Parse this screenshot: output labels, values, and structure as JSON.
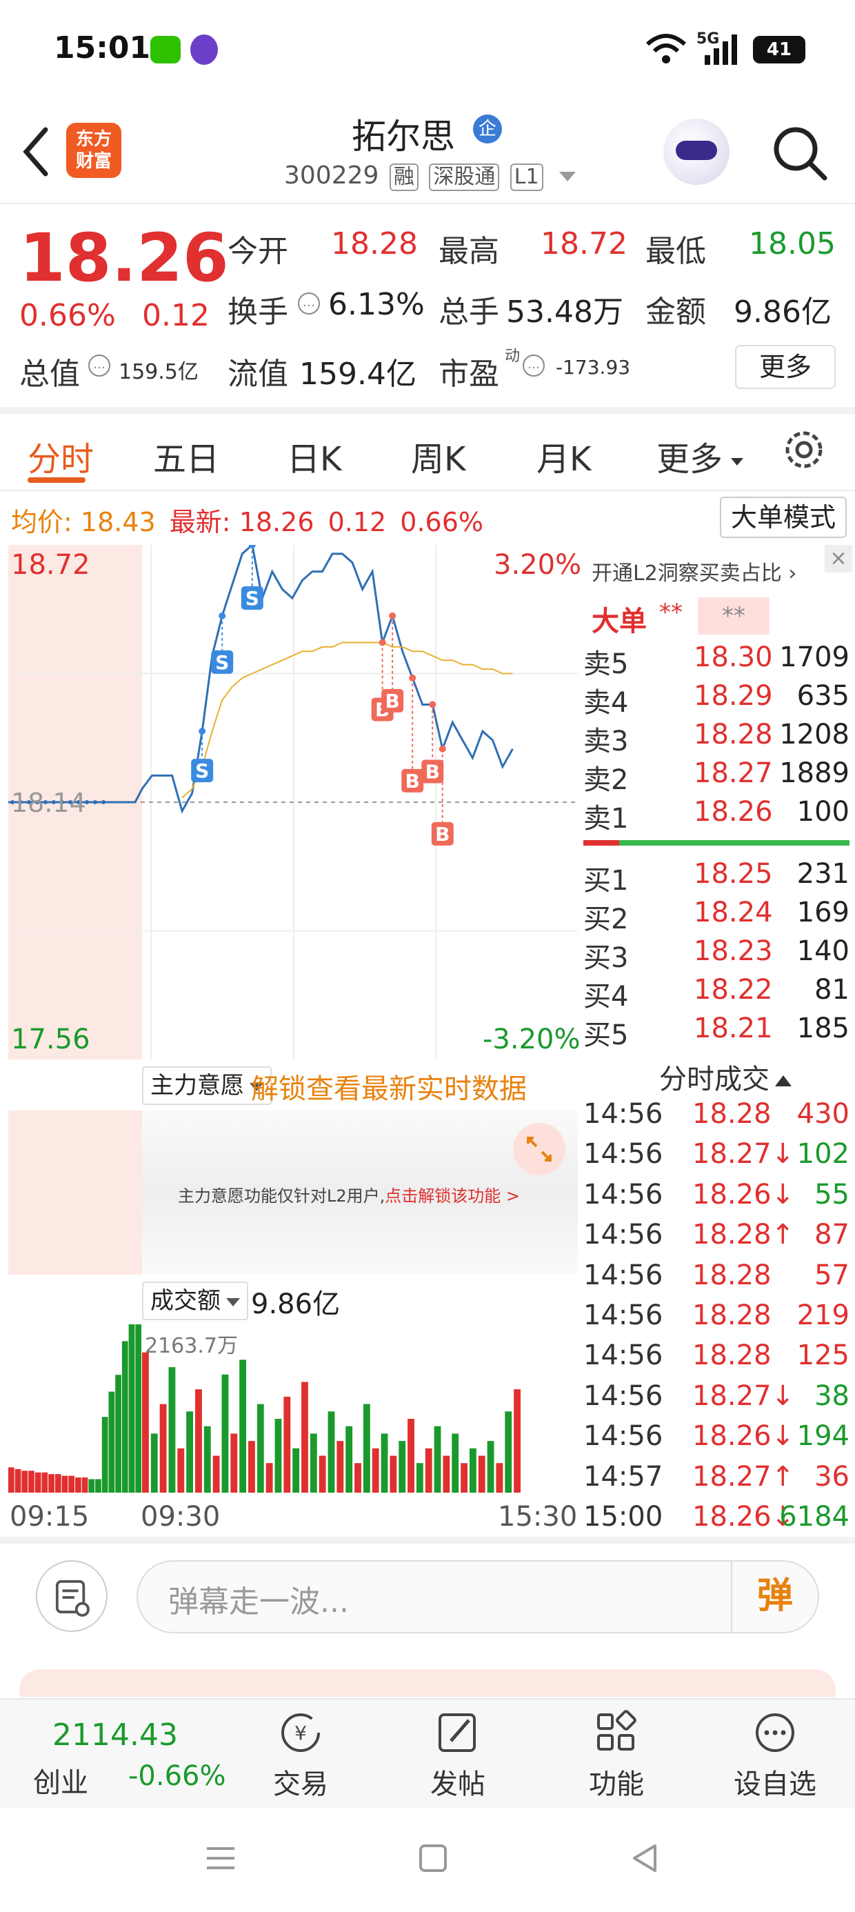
{
  "status_bar": {
    "time": "15:01",
    "network": "5G",
    "battery": "41"
  },
  "header": {
    "stock_name": "拓尔思",
    "badge": "企",
    "code": "300229",
    "tags": [
      "融",
      "深股通",
      "L1"
    ],
    "logo_line1": "东方",
    "logo_line2": "财富"
  },
  "quote": {
    "price": "18.26",
    "change_pct": "0.66%",
    "change": "0.12",
    "open_label": "今开",
    "open": "18.28",
    "high_label": "最高",
    "high": "18.72",
    "low_label": "最低",
    "low": "18.05",
    "turnover_label": "换手",
    "turnover": "6.13%",
    "volume_label": "总手",
    "volume": "53.48万",
    "amount_label": "金额",
    "amount": "9.86亿",
    "mktcap_label": "总值",
    "mktcap": "159.5亿",
    "float_label": "流值",
    "float": "159.4亿",
    "pe_label": "市盈",
    "pe_sup": "动",
    "pe": "-173.93",
    "more": "更多"
  },
  "tabs": [
    "分时",
    "五日",
    "日K",
    "周K",
    "月K",
    "更多"
  ],
  "avg_bar": {
    "avg_label": "均价:",
    "avg": "18.43",
    "latest_label": "最新:",
    "latest": "18.26",
    "latest_chg": "0.12",
    "latest_pct": "0.66%",
    "big_order_btn": "大单模式"
  },
  "chart_labels": {
    "high": "18.72",
    "low": "17.56",
    "pre_close": "18.14",
    "up_pct": "3.20%",
    "down_pct": "-3.20%"
  },
  "order_book": {
    "l2_link": "开通L2洞察买卖占比 ›",
    "big_label": "大单",
    "stars_a": "**",
    "stars_b": "**",
    "asks": [
      {
        "label": "卖5",
        "price": "18.30",
        "vol": "1709"
      },
      {
        "label": "卖4",
        "price": "18.29",
        "vol": "635"
      },
      {
        "label": "卖3",
        "price": "18.28",
        "vol": "1208"
      },
      {
        "label": "卖2",
        "price": "18.27",
        "vol": "1889"
      },
      {
        "label": "卖1",
        "price": "18.26",
        "vol": "100"
      }
    ],
    "bids": [
      {
        "label": "买1",
        "price": "18.25",
        "vol": "231"
      },
      {
        "label": "买2",
        "price": "18.24",
        "vol": "169"
      },
      {
        "label": "买3",
        "price": "18.23",
        "vol": "140"
      },
      {
        "label": "买4",
        "price": "18.22",
        "vol": "81"
      },
      {
        "label": "买5",
        "price": "18.21",
        "vol": "185"
      }
    ]
  },
  "ticks": {
    "title": "分时成交",
    "rows": [
      {
        "time": "14:56",
        "price": "18.28",
        "arrow": "",
        "vol": "430",
        "color": "#e0302f"
      },
      {
        "time": "14:56",
        "price": "18.27↓",
        "arrow": "down",
        "vol": "102",
        "color": "#1a9a2c"
      },
      {
        "time": "14:56",
        "price": "18.26↓",
        "arrow": "down",
        "vol": "55",
        "color": "#1a9a2c"
      },
      {
        "time": "14:56",
        "price": "18.28↑",
        "arrow": "up",
        "vol": "87",
        "color": "#e0302f"
      },
      {
        "time": "14:56",
        "price": "18.28",
        "arrow": "",
        "vol": "57",
        "color": "#e0302f"
      },
      {
        "time": "14:56",
        "price": "18.28",
        "arrow": "",
        "vol": "219",
        "color": "#e0302f"
      },
      {
        "time": "14:56",
        "price": "18.28",
        "arrow": "",
        "vol": "125",
        "color": "#e0302f"
      },
      {
        "time": "14:56",
        "price": "18.27↓",
        "arrow": "down",
        "vol": "38",
        "color": "#1a9a2c"
      },
      {
        "time": "14:56",
        "price": "18.26↓",
        "arrow": "down",
        "vol": "194",
        "color": "#1a9a2c"
      },
      {
        "time": "14:57",
        "price": "18.27↑",
        "arrow": "up",
        "vol": "36",
        "color": "#e0302f"
      },
      {
        "time": "15:00",
        "price": "18.26↓",
        "arrow": "down",
        "vol": "6184",
        "color": "#1a9a2c"
      }
    ]
  },
  "main_force": {
    "dropdown": "主力意愿",
    "unlock_title": "解锁查看最新实时数据",
    "note": "主力意愿功能仅针对L2用户,",
    "note_link": "点击解锁该功能 >"
  },
  "volume_panel": {
    "dropdown": "成交额",
    "total": "9.86亿",
    "max_label": "2163.7万",
    "t_start": "09:15",
    "t_open": "09:30",
    "t_end": "15:30"
  },
  "danmu": {
    "placeholder": "弹幕走一波...",
    "send": "弹"
  },
  "bottom_bar": {
    "index_value": "2114.43",
    "index_name": "创业",
    "index_pct": "-0.66%",
    "items": [
      "交易",
      "发帖",
      "功能",
      "设自选"
    ]
  },
  "chart_data": {
    "type": "line",
    "title": "",
    "series": [
      {
        "name": "",
        "values": [
          18.14,
          18.14,
          18.14,
          18.14,
          18.14,
          18.17,
          18.2,
          18.2,
          18.2,
          18.12,
          18.16,
          18.3,
          18.47,
          18.56,
          18.63,
          18.7,
          18.72,
          18.6,
          18.66,
          18.62,
          18.6,
          18.64,
          18.66,
          18.66,
          18.7,
          18.7,
          18.68,
          18.62,
          18.66,
          18.5,
          18.56,
          18.48,
          18.42,
          18.36,
          18.36,
          18.26,
          18.32,
          18.28,
          18.24,
          18.3,
          18.28,
          18.22,
          18.26
        ]
      },
      {
        "name": "",
        "values": [
          null,
          null,
          null,
          null,
          null,
          null,
          null,
          null,
          null,
          18.15,
          18.17,
          18.22,
          18.3,
          18.37,
          18.4,
          18.42,
          18.43,
          18.44,
          18.45,
          18.46,
          18.47,
          18.48,
          18.48,
          18.49,
          18.49,
          18.5,
          18.5,
          18.5,
          18.5,
          18.5,
          18.49,
          18.49,
          18.48,
          18.48,
          18.47,
          18.46,
          18.46,
          18.45,
          18.45,
          18.44,
          18.44,
          18.43,
          18.43
        ]
      }
    ],
    "ylim": [
      17.56,
      18.72
    ],
    "pre_close": 18.14,
    "markers": [
      {
        "type": "S",
        "index": 11
      },
      {
        "type": "S",
        "index": 13
      },
      {
        "type": "S",
        "index": 16
      },
      {
        "type": "B",
        "index": 29
      },
      {
        "type": "B",
        "index": 30
      },
      {
        "type": "B",
        "index": 32
      },
      {
        "type": "B",
        "index": 34
      },
      {
        "type": "B",
        "index": 35
      }
    ],
    "volume": {
      "type": "bar",
      "pre_values": [
        30,
        28,
        26,
        26,
        24,
        24,
        22,
        22,
        20,
        20,
        18,
        18,
        16,
        16,
        90,
        120,
        140,
        180,
        200,
        200
      ],
      "pre_colors": [
        "r",
        "r",
        "r",
        "r",
        "r",
        "r",
        "r",
        "r",
        "r",
        "r",
        "r",
        "r",
        "g",
        "g",
        "g",
        "g",
        "g",
        "g",
        "g",
        "g"
      ],
      "values": [
        95,
        40,
        60,
        85,
        30,
        55,
        70,
        45,
        25,
        80,
        40,
        90,
        35,
        60,
        20,
        50,
        65,
        30,
        75,
        40,
        25,
        55,
        35,
        45,
        20,
        60,
        30,
        40,
        25,
        35,
        50,
        20,
        30,
        45,
        25,
        40,
        20,
        30,
        25,
        35,
        20,
        55,
        70
      ]
    }
  }
}
